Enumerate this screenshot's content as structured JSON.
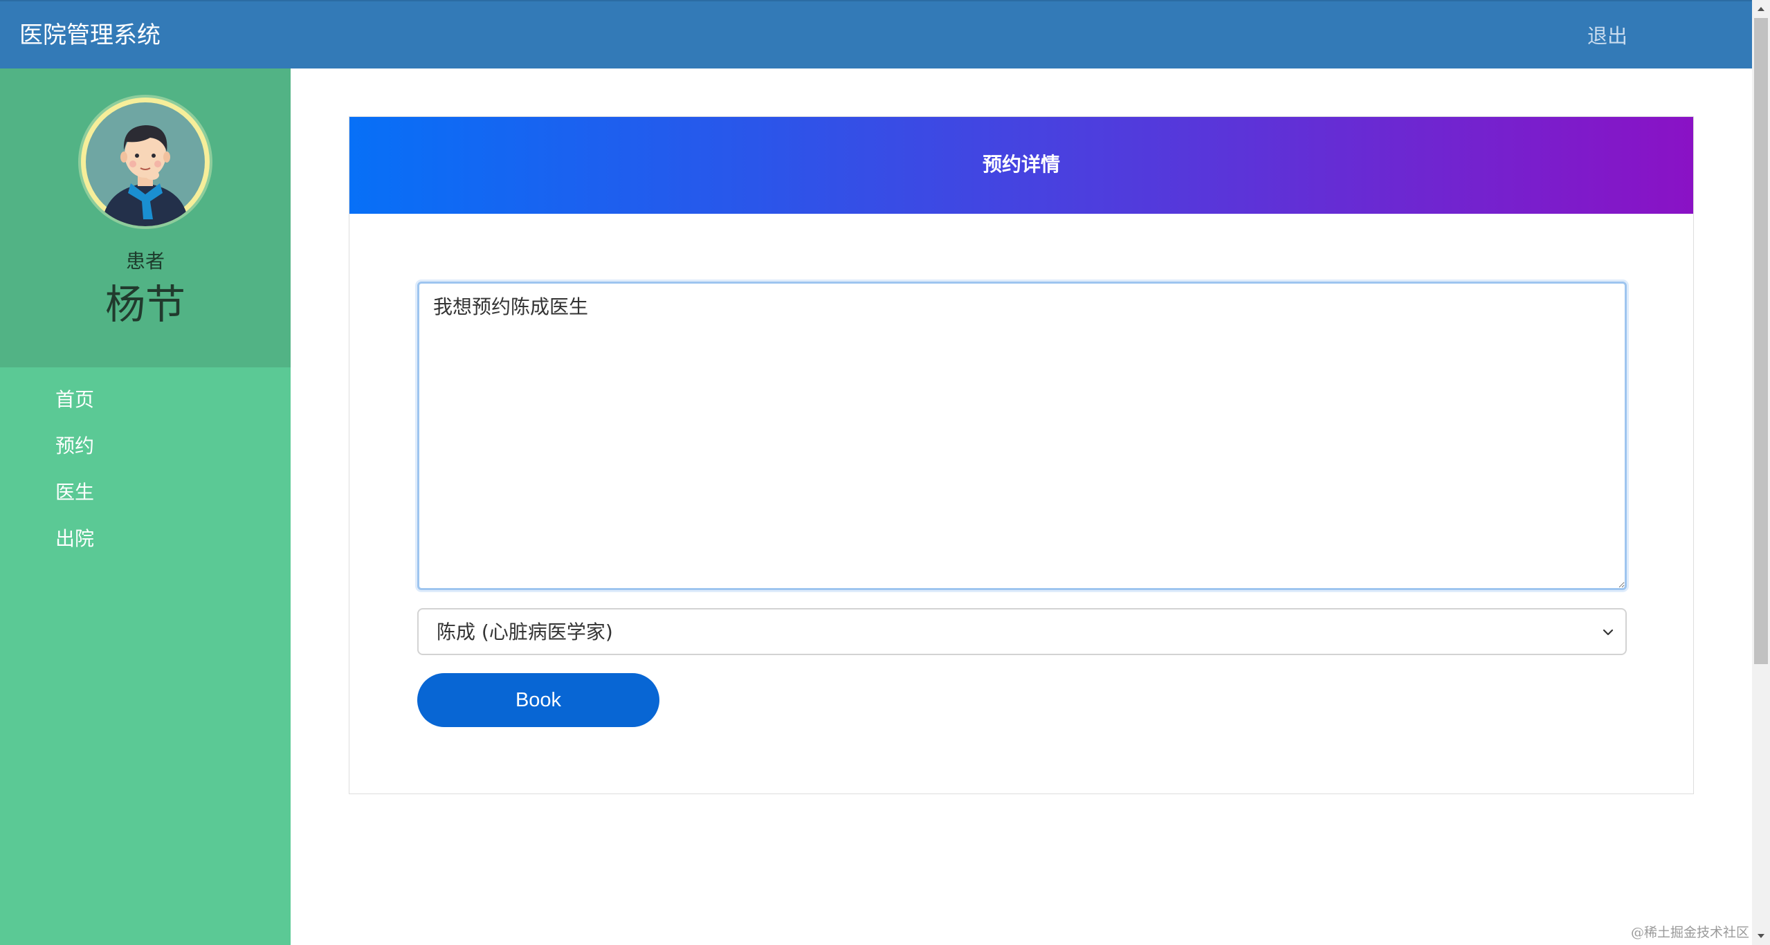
{
  "app": {
    "title": "医院管理系统",
    "logout_label": "退出"
  },
  "profile": {
    "role": "患者",
    "name": "杨节",
    "avatar_icon": "patient-avatar-icon"
  },
  "sidebar": {
    "items": [
      {
        "label": "首页"
      },
      {
        "label": "预约"
      },
      {
        "label": "医生"
      },
      {
        "label": "出院"
      }
    ]
  },
  "appointment": {
    "header_title": "预约详情",
    "message": "我想预约陈成医生",
    "selected_doctor": "陈成 (心脏病医学家)",
    "book_label": "Book"
  },
  "watermark": "@稀土掘金技术社区",
  "colors": {
    "navbar": "#337ab7",
    "sidebar": "#5bc995",
    "profile_panel": "#52b385",
    "book_button": "#0866d4",
    "header_gradient_start": "#0770f7",
    "header_gradient_end": "#8a12c5"
  }
}
